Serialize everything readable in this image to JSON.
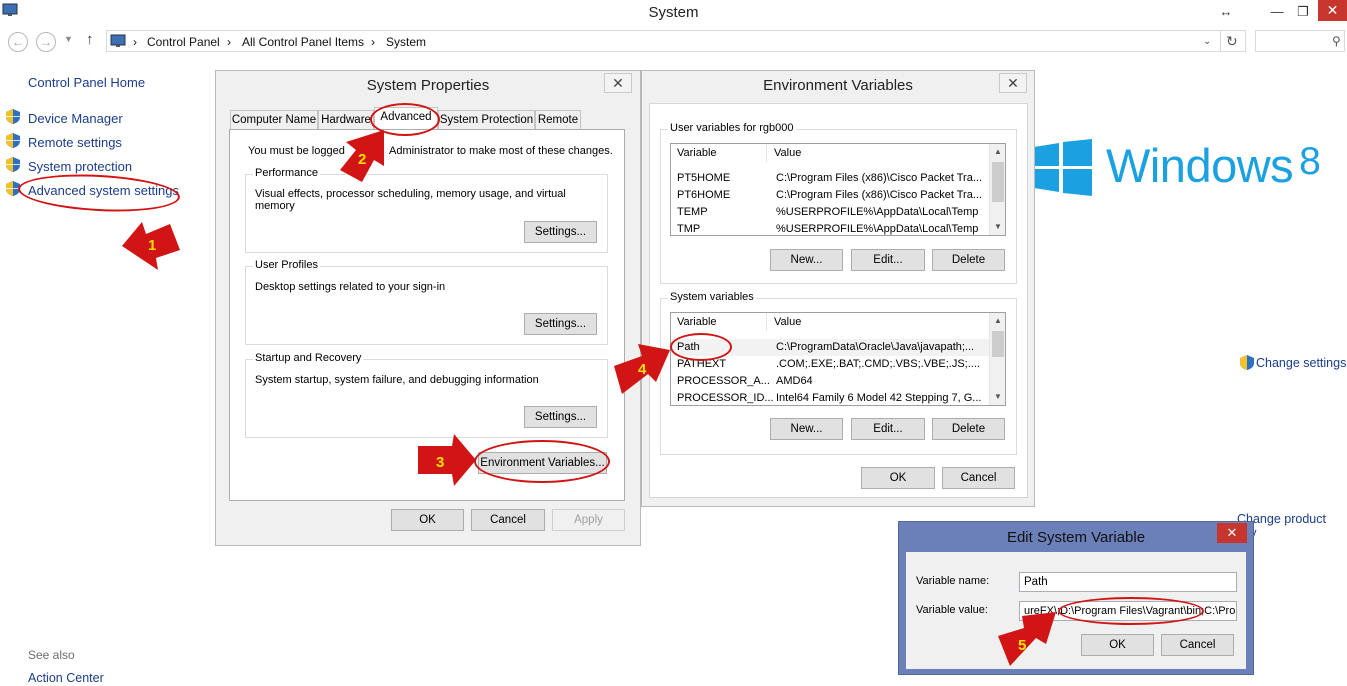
{
  "window": {
    "title": "System"
  },
  "nav": {
    "breadcrumb": [
      "Control Panel",
      "All Control Panel Items",
      "System"
    ],
    "sep": "›"
  },
  "left_pane": {
    "home": "Control Panel Home",
    "links": [
      "Device Manager",
      "Remote settings",
      "System protection",
      "Advanced system settings"
    ],
    "see_also": "See also",
    "action_center": "Action Center"
  },
  "right_pane": {
    "brand": "Windows",
    "version": "8",
    "change_settings": "Change settings",
    "change_product_key": "Change product key"
  },
  "system_properties": {
    "title": "System Properties",
    "close": "✕",
    "tabs": [
      "Computer Name",
      "Hardware",
      "Advanced",
      "System Protection",
      "Remote"
    ],
    "notice": "You must be logged on as an Administrator to make most of these changes.",
    "notice_visible_left": "You must be logged",
    "notice_visible_right": "Administrator to make most of these changes.",
    "performance": {
      "label": "Performance",
      "text": "Visual effects, processor scheduling, memory usage, and virtual memory",
      "button": "Settings..."
    },
    "user_profiles": {
      "label": "User Profiles",
      "text": "Desktop settings related to your sign-in",
      "button": "Settings..."
    },
    "startup": {
      "label": "Startup and Recovery",
      "text": "System startup, system failure, and debugging information",
      "button": "Settings..."
    },
    "env_button": "Environment Variables...",
    "ok": "OK",
    "cancel": "Cancel",
    "apply": "Apply"
  },
  "env_vars": {
    "title": "Environment Variables",
    "close": "✕",
    "user_group": "User variables for rgb000",
    "col_variable": "Variable",
    "col_value": "Value",
    "user_rows": [
      {
        "name": "PT5HOME",
        "value": "C:\\Program Files (x86)\\Cisco Packet Tra..."
      },
      {
        "name": "PT6HOME",
        "value": "C:\\Program Files (x86)\\Cisco Packet Tra..."
      },
      {
        "name": "TEMP",
        "value": "%USERPROFILE%\\AppData\\Local\\Temp"
      },
      {
        "name": "TMP",
        "value": "%USERPROFILE%\\AppData\\Local\\Temp"
      }
    ],
    "system_group": "System variables",
    "system_rows": [
      {
        "name": "Path",
        "value": "C:\\ProgramData\\Oracle\\Java\\javapath;..."
      },
      {
        "name": "PATHEXT",
        "value": ".COM;.EXE;.BAT;.CMD;.VBS;.VBE;.JS;...."
      },
      {
        "name": "PROCESSOR_A...",
        "value": "AMD64"
      },
      {
        "name": "PROCESSOR_ID...",
        "value": "Intel64 Family 6 Model 42 Stepping 7, G..."
      }
    ],
    "new": "New...",
    "edit": "Edit...",
    "delete": "Delete",
    "ok": "OK",
    "cancel": "Cancel"
  },
  "edit_var": {
    "title": "Edit System Variable",
    "close": "✕",
    "name_label": "Variable name:",
    "name_value": "Path",
    "value_label": "Variable value:",
    "value_value": "ureFX\\;D:\\Program Files\\Vagrant\\bin;C:\\Pro",
    "ok": "OK",
    "cancel": "Cancel"
  },
  "annotations": {
    "step_labels": [
      "1",
      "2",
      "3",
      "4",
      "5"
    ],
    "color": "#d11414"
  },
  "colors": {
    "link": "#1a3d8c",
    "windows_blue": "#1ba1e2",
    "close_red": "#c7362c",
    "edit_dialog_frame": "#6b7fb8"
  }
}
